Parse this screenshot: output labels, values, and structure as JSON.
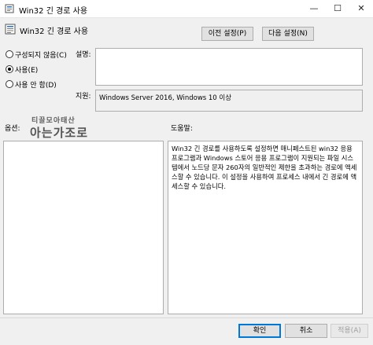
{
  "window": {
    "title": "Win32 긴 경로 사용",
    "minimize_symbol": "—",
    "maximize_symbol": "☐",
    "close_symbol": "✕"
  },
  "header": {
    "policy_name": "Win32 긴 경로 사용",
    "prev_button": "이전 설정(P)",
    "next_button": "다음 설정(N)"
  },
  "state": {
    "options": [
      {
        "label": "구성되지 않음(C)",
        "selected": false
      },
      {
        "label": "사용(E)",
        "selected": true
      },
      {
        "label": "사용 안 함(D)",
        "selected": false
      }
    ]
  },
  "comment": {
    "label": "설명:",
    "value": ""
  },
  "supported": {
    "label": "지원:",
    "value": "Windows Server 2016, Windows 10 이상"
  },
  "watermark": {
    "line1": "티끌모아태산",
    "line2": "아는가조로"
  },
  "options_panel": {
    "label": "옵션:"
  },
  "help_panel": {
    "label": "도움말:",
    "text": "Win32 긴 경로를 사용하도록 설정하면 매니페스트된 win32 응용 프로그램과 Windows 스토어 응용 프로그램이 지원되는 파일 시스템에서 노드당 문자 260자의 일반적인 제한을 초과하는 경로에 액세스할 수 있습니다. 이 설정을 사용하여 프로세스 내에서 긴 경로에 액세스할 수 있습니다."
  },
  "footer": {
    "ok": "확인",
    "cancel": "취소",
    "apply": "적용(A)"
  }
}
